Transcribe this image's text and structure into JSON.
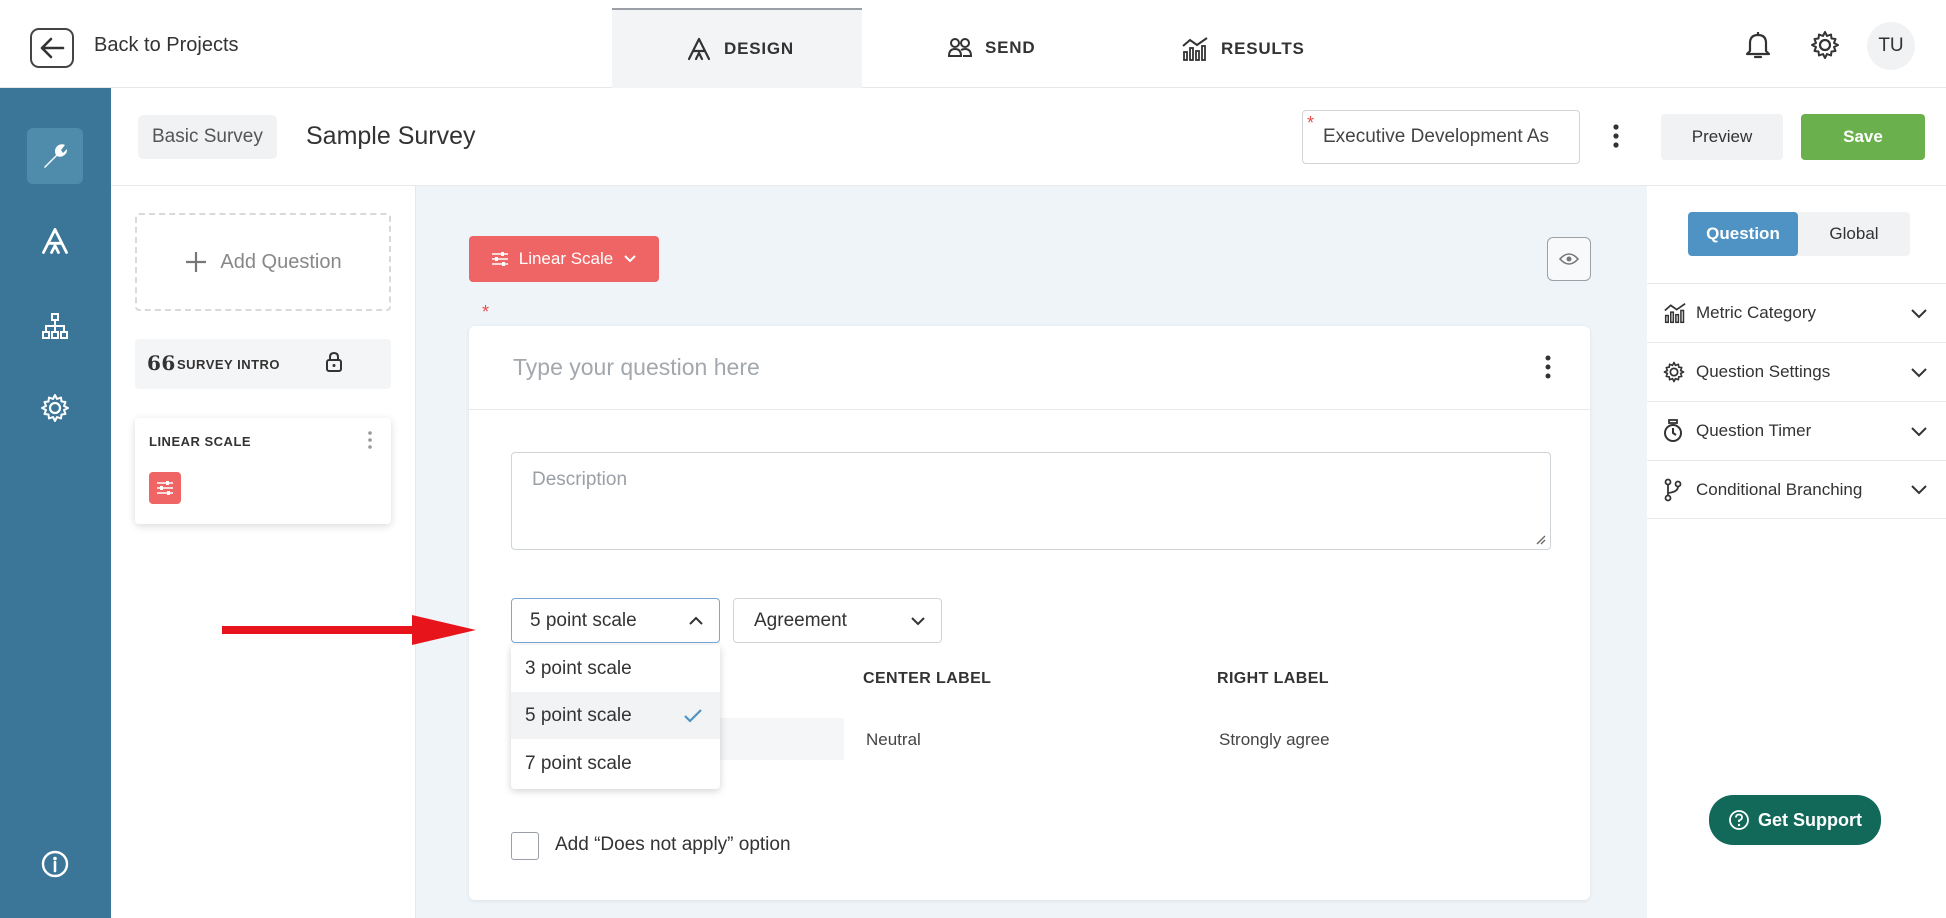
{
  "topbar": {
    "back_label": "Back to Projects",
    "tabs": [
      {
        "label": "DESIGN",
        "icon": "design-icon",
        "active": true
      },
      {
        "label": "SEND",
        "icon": "users-icon",
        "active": false
      },
      {
        "label": "RESULTS",
        "icon": "results-chart-icon",
        "active": false
      }
    ],
    "avatar_initials": "TU"
  },
  "sidebar": {
    "items": [
      {
        "icon": "wrench-icon",
        "active": true
      },
      {
        "icon": "design-icon",
        "active": false
      },
      {
        "icon": "hierarchy-icon",
        "active": false
      },
      {
        "icon": "gear-icon",
        "active": false
      }
    ],
    "bottom_icon": "info-icon"
  },
  "header": {
    "survey_type": "Basic Survey",
    "survey_name": "Sample Survey",
    "project_select": "Executive Development As",
    "preview_label": "Preview",
    "save_label": "Save"
  },
  "left_panel": {
    "add_question": "Add Question",
    "intro_label": "SURVEY INTRO",
    "question_card_label": "LINEAR SCALE"
  },
  "editor": {
    "question_type": "Linear Scale",
    "question_placeholder": "Type your question here",
    "description_placeholder": "Description",
    "scale_select": "5 point scale",
    "scale_options": [
      "3 point scale",
      "5 point scale",
      "7 point scale"
    ],
    "selected_option": "5 point scale",
    "type_select": "Agreement",
    "center_label_header": "CENTER LABEL",
    "right_label_header": "RIGHT LABEL",
    "center_label_value": "Neutral",
    "right_label_value": "Strongly agree",
    "does_not_apply": "Add “Does not apply” option"
  },
  "right_panel": {
    "tabs": [
      "Question",
      "Global"
    ],
    "active_tab": "Question",
    "sections": [
      {
        "label": "Metric Category",
        "icon": "metric-chart-icon"
      },
      {
        "label": "Question Settings",
        "icon": "gear-icon"
      },
      {
        "label": "Question Timer",
        "icon": "timer-icon"
      },
      {
        "label": "Conditional Branching",
        "icon": "branch-icon"
      }
    ]
  },
  "support_label": "Get Support",
  "colors": {
    "sidebar": "#3b7699",
    "accent_red": "#ef6464",
    "save_green": "#6ab04c",
    "tab_blue": "#4f93c5",
    "support_green": "#12695a",
    "arrow_red": "#e8141b"
  }
}
